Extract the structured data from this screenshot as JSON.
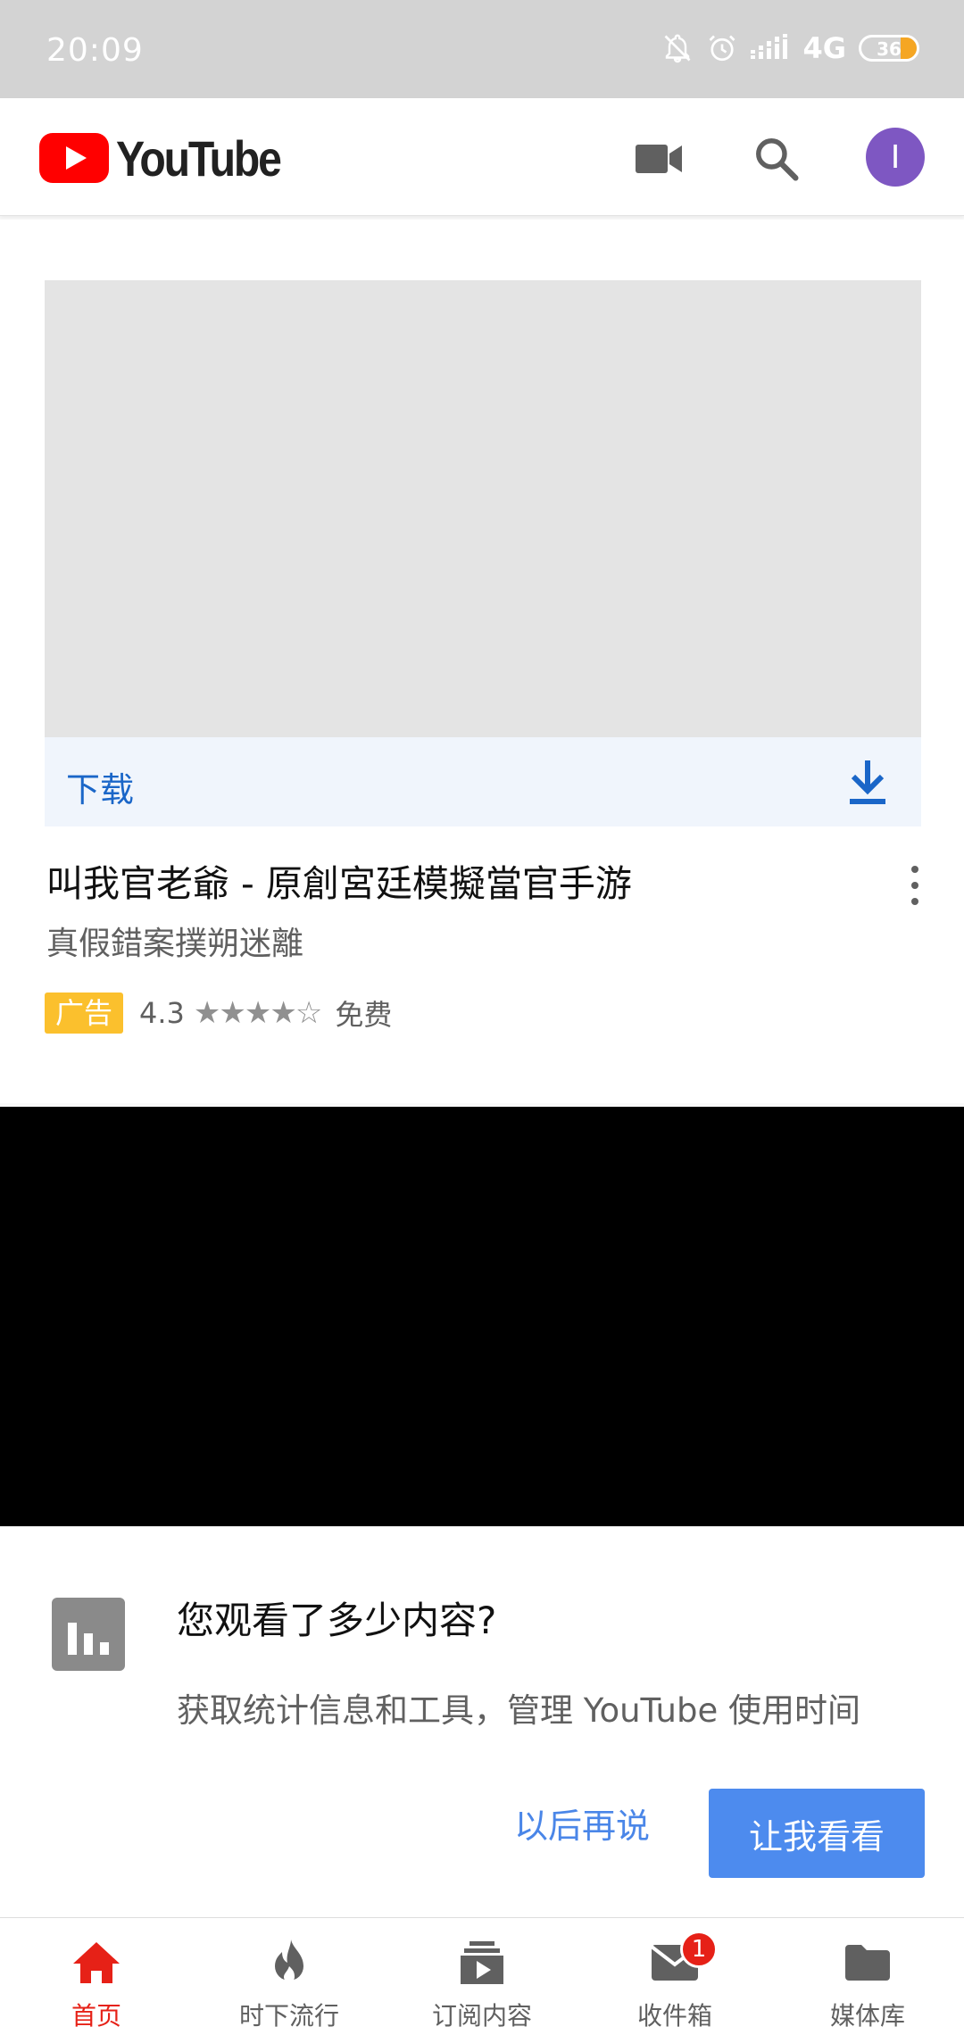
{
  "status_bar": {
    "time": "20:09",
    "network": "4G",
    "battery": "36",
    "icons": [
      "bell-off-icon",
      "alarm-icon",
      "signal-icon",
      "battery-icon"
    ]
  },
  "app_bar": {
    "brand": "YouTube",
    "brand_color": "#ff0000",
    "avatar_initial": "I",
    "avatar_color": "#7e57c2",
    "icons": [
      "camera-icon",
      "search-icon"
    ]
  },
  "ad": {
    "download_label": "下载",
    "title": "叫我官老爺 - 原創宮廷模擬當官手游",
    "subtitle": "真假錯案撲朔迷離",
    "badge": "广告",
    "rating": "4.3",
    "rating_value": 4.3,
    "rating_max": 5,
    "price": "免费"
  },
  "prompt": {
    "title": "您观看了多少内容?",
    "description": "获取统计信息和工具，管理 YouTube 使用时间",
    "later_label": "以后再说",
    "show_label": "让我看看",
    "accent_color": "#4d8bee"
  },
  "bottom_nav": {
    "active_color": "#e62117",
    "items": [
      {
        "label": "首页",
        "icon": "home-icon",
        "active": true
      },
      {
        "label": "时下流行",
        "icon": "trending-flame-icon",
        "active": false
      },
      {
        "label": "订阅内容",
        "icon": "subscriptions-icon",
        "active": false
      },
      {
        "label": "收件箱",
        "icon": "inbox-icon",
        "active": false,
        "badge": "1"
      },
      {
        "label": "媒体库",
        "icon": "library-folder-icon",
        "active": false
      }
    ]
  }
}
